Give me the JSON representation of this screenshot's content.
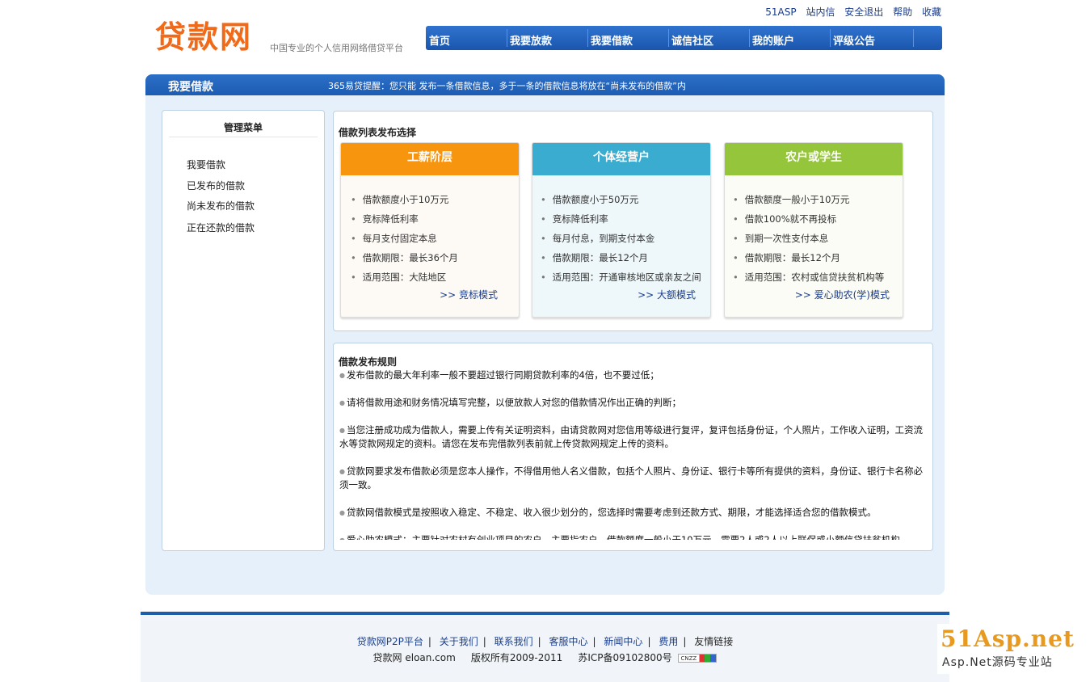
{
  "header": {
    "logo": "贷款网",
    "slogan": "中国专业的个人信用网络借贷平台",
    "top_links": [
      "51ASP",
      "站内信",
      "安全退出",
      "帮助",
      "收藏"
    ],
    "nav": [
      "首页",
      "我要放款",
      "我要借款",
      "诚信社区",
      "我的账户",
      "评级公告"
    ]
  },
  "section": {
    "title": "我要借款",
    "notice": "365易贷提醒：您只能 发布一条借款信息，多于一条的借款信息将放在“尚未发布的借款”内"
  },
  "menu": {
    "title": "管理菜单",
    "items": [
      "我要借款",
      "已发布的借款",
      "尚未发布的借款",
      "正在还款的借款"
    ]
  },
  "loan_types": {
    "title": "借款列表发布选择",
    "cards": [
      {
        "name": "工薪阶层",
        "color": "#f7950f",
        "bg": "#fdfaf5",
        "items": [
          "借款额度小于10万元",
          "竞标降低利率",
          "每月支付固定本息",
          "借款期限：最长36个月",
          "适用范围：大陆地区"
        ],
        "link": ">> 竞标模式"
      },
      {
        "name": "个体经营户",
        "color": "#3aaccf",
        "bg": "#eef7fa",
        "items": [
          "借款额度小于50万元",
          "竞标降低利率",
          "每月付息，到期支付本金",
          "借款期限：最长12个月",
          "适用范围：开通审核地区或亲友之间"
        ],
        "link": ">> 大额模式"
      },
      {
        "name": "农户或学生",
        "color": "#95c53b",
        "bg": "#fbfcf6",
        "items": [
          "借款额度一般小于10万元",
          "借款100%就不再投标",
          "到期一次性支付本息",
          "借款期限：最长12个月",
          "适用范围：农村或信贷扶贫机构等"
        ],
        "link": ">> 爱心助农(学)模式"
      }
    ]
  },
  "rules": {
    "title": "借款发布规则",
    "items": [
      "发布借款的最大年利率一般不要超过银行同期贷款利率的4倍，也不要过低；",
      "请将借款用途和财务情况填写完整，以便放款人对您的借款情况作出正确的判断；",
      "当您注册成功成为借款人，需要上传有关证明资料，由请贷款网对您信用等级进行复评，复评包括身份证，个人照片，工作收入证明，工资流水等贷款网规定的资料。请您在发布完借款列表前就上传贷款网规定上传的资料。",
      "贷款网要求发布借款必须是您本人操作，不得借用他人名义借款，包括个人照片、身份证、银行卡等所有提供的资料，身份证、银行卡名称必须一致。",
      "贷款网借款模式是按照收入稳定、不稳定、收入很少划分的，您选择时需要考虑到还款方式、期限，才能选择适合您的借款模式。",
      "爱心助农模式：主要针对农村有创业项目的农户，主要指农户，借款额度一般小于10万元，需要2人或2人以上联保或小额信贷扶贫机构"
    ]
  },
  "footer": {
    "links": [
      "贷款网P2P平台",
      "关于我们",
      "联系我们",
      "客服中心",
      "新闻中心",
      "费用"
    ],
    "last_link": "友情链接",
    "site": "贷款网 eloan.com",
    "copyright": "版权所有2009-2011",
    "icp": "苏ICP备09102800号",
    "badge": "CNZZ"
  },
  "watermark": {
    "main": "51Asp.net",
    "sub": "Asp.Net源码专业站"
  }
}
